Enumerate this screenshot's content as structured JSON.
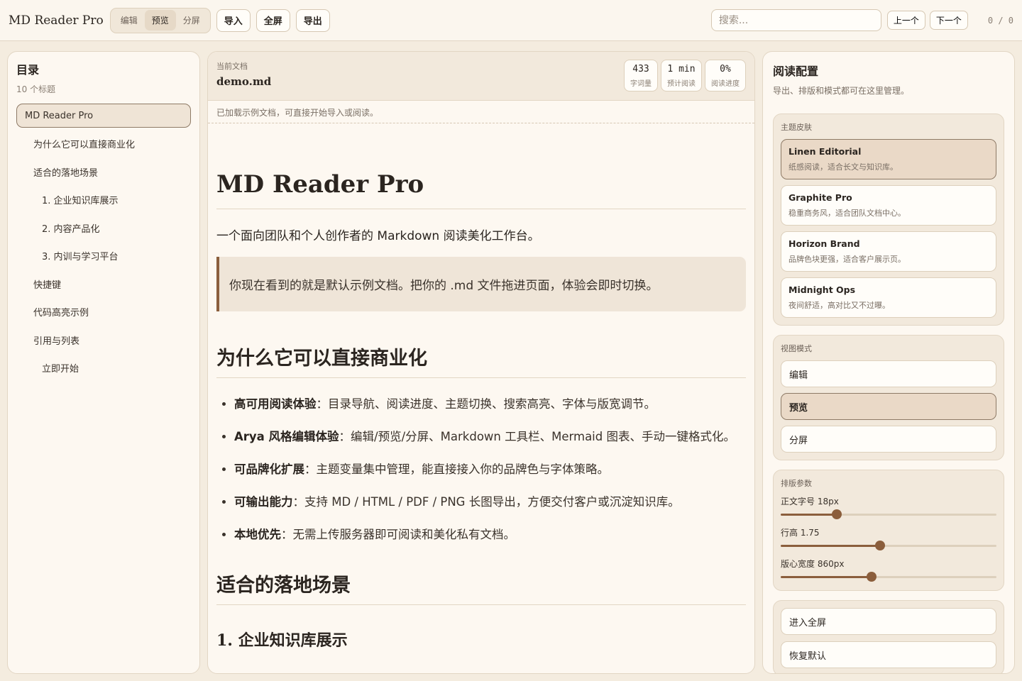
{
  "app": {
    "title": "MD Reader Pro"
  },
  "topbar": {
    "modes": [
      "编辑",
      "预览",
      "分屏"
    ],
    "active_mode": 1,
    "import_label": "导入",
    "fullscreen_label": "全屏",
    "export_label": "导出",
    "search_placeholder": "搜索...",
    "prev_label": "上一个",
    "next_label": "下一个",
    "match_counter": "0 / 0"
  },
  "toc": {
    "title": "目录",
    "count_label": "10 个标题",
    "items": [
      {
        "label": "MD Reader Pro",
        "level": 1,
        "active": true
      },
      {
        "label": "为什么它可以直接商业化",
        "level": 2
      },
      {
        "label": "适合的落地场景",
        "level": 2
      },
      {
        "label": "1. 企业知识库展示",
        "level": 3
      },
      {
        "label": "2. 内容产品化",
        "level": 3
      },
      {
        "label": "3. 内训与学习平台",
        "level": 3
      },
      {
        "label": "快捷键",
        "level": 2
      },
      {
        "label": "代码高亮示例",
        "level": 2
      },
      {
        "label": "引用与列表",
        "level": 2
      },
      {
        "label": "立即开始",
        "level": 3
      }
    ]
  },
  "document": {
    "current_label": "当前文档",
    "filename": "demo.md",
    "stats": [
      {
        "value": "433",
        "label": "字词量"
      },
      {
        "value": "1 min",
        "label": "预计阅读"
      },
      {
        "value": "0%",
        "label": "阅读进度"
      }
    ],
    "status": "已加载示例文档，可直接开始导入或阅读。",
    "h1": "MD Reader Pro",
    "lead": "一个面向团队和个人创作者的 Markdown 阅读美化工作台。",
    "quote": "你现在看到的就是默认示例文档。把你的 .md 文件拖进页面，体验会即时切换。",
    "h2_why": "为什么它可以直接商业化",
    "bullets": [
      {
        "strong": "高可用阅读体验",
        "text": "：目录导航、阅读进度、主题切换、搜索高亮、字体与版宽调节。"
      },
      {
        "strong": "Arya 风格编辑体验",
        "text": "：编辑/预览/分屏、Markdown 工具栏、Mermaid 图表、手动一键格式化。"
      },
      {
        "strong": "可品牌化扩展",
        "text": "：主题变量集中管理，能直接接入你的品牌色与字体策略。"
      },
      {
        "strong": "可输出能力",
        "text": "：支持 MD / HTML / PDF / PNG 长图导出，方便交付客户或沉淀知识库。"
      },
      {
        "strong": "本地优先",
        "text": "：无需上传服务器即可阅读和美化私有文档。"
      }
    ],
    "h2_scenes": "适合的落地场景",
    "h3_first": "1. 企业知识库展示"
  },
  "config": {
    "title": "阅读配置",
    "subtitle": "导出、排版和模式都可在这里管理。",
    "theme_group_label": "主题皮肤",
    "themes": [
      {
        "name": "Linen Editorial",
        "desc": "纸感阅读，适合长文与知识库。",
        "active": true
      },
      {
        "name": "Graphite Pro",
        "desc": "稳重商务风，适合团队文档中心。"
      },
      {
        "name": "Horizon Brand",
        "desc": "品牌色块更强，适合客户展示页。"
      },
      {
        "name": "Midnight Ops",
        "desc": "夜间舒适，高对比又不过曝。"
      }
    ],
    "view_group_label": "视图模式",
    "views": [
      "编辑",
      "预览",
      "分屏"
    ],
    "active_view": 1,
    "layout_group_label": "排版参数",
    "sliders": [
      {
        "label": "正文字号 18px",
        "fraction": 0.26
      },
      {
        "label": "行高 1.75",
        "fraction": 0.46
      },
      {
        "label": "版心宽度 860px",
        "fraction": 0.42
      }
    ],
    "actions": [
      "进入全屏",
      "恢复默认"
    ]
  },
  "colors": {
    "accent": "#8b5e3c",
    "background": "#f4ecdf",
    "panel": "#fdf8f1",
    "active": "#ead9c7"
  }
}
